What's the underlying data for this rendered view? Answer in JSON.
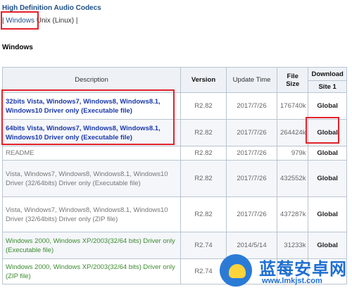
{
  "page": {
    "heading": "High Definition Audio Codecs",
    "os_links": {
      "pipe": "|",
      "windows": "Windows",
      "unix": "Unix (Linux)"
    },
    "section_title": "Windows"
  },
  "table": {
    "headers": {
      "description": "Description",
      "version": "Version",
      "update_time": "Update Time",
      "file_size": "File Size",
      "download": "Download",
      "site": "Site 1"
    },
    "rows": [
      {
        "description": "32bits Vista, Windows7, Windows8, Windows8.1, Windows10 Driver only (Executable file)",
        "version": "R2.82",
        "update_time": "2017/7/26",
        "size": "176740k",
        "download": "Global"
      },
      {
        "description": "64bits Vista, Windows7, Windows8, Windows8.1, Windows10 Driver only (Executable file)",
        "version": "R2.82",
        "update_time": "2017/7/26",
        "size": "264424k",
        "download": "Global"
      },
      {
        "description": "README",
        "version": "R2.82",
        "update_time": "2017/7/26",
        "size": "979k",
        "download": "Global"
      },
      {
        "description": "Vista, Windows7, Windows8, Windows8.1, Windows10 Driver (32/64bits) Driver only (Executable file)",
        "version": "R2.82",
        "update_time": "2017/7/26",
        "size": "432552k",
        "download": "Global"
      },
      {
        "description": "Vista, Windows7, Windows8, Windows8.1, Windows10 Driver (32/64bits) Driver only (ZIP file)",
        "version": "R2.82",
        "update_time": "2017/7/26",
        "size": "437287k",
        "download": "Global"
      },
      {
        "description": "Windows 2000, Windows XP/2003(32/64 bits) Driver only (Executable file)",
        "version": "R2.74",
        "update_time": "2014/5/14",
        "size": "31233k",
        "download": "Global"
      },
      {
        "description": "Windows 2000, Windows XP/2003(32/64 bits) Driver only (ZIP file)",
        "version": "R2.74",
        "update_time": "",
        "size": "",
        "download": ""
      }
    ]
  },
  "watermark": {
    "title": "蓝莓安卓网",
    "url": "www.lmkjst.com"
  },
  "colors": {
    "highlight": "#e2222a",
    "link_blue": "#1c3aa8",
    "green_text": "#3d8b2f",
    "header_bg": "#eef2f7"
  }
}
